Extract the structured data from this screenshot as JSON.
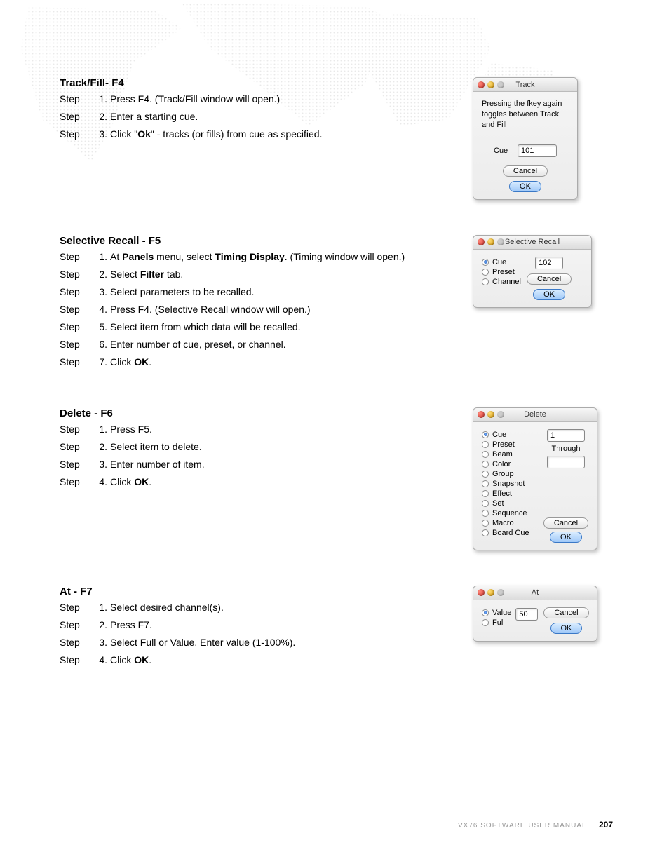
{
  "footer": {
    "text": "VX76 SOFTWARE USER MANUAL",
    "page": "207"
  },
  "sections": {
    "track": {
      "heading": "Track/Fill- F4",
      "steps": [
        "Press F4. (Track/Fill window will open.)",
        "Enter a starting cue.",
        "Click \"<b>Ok</b>\" - tracks (or fills) from cue as specified."
      ],
      "dialog": {
        "title": "Track",
        "message": "Pressing the fkey again toggles between Track and Fill",
        "cue_label": "Cue",
        "cue_value": "101",
        "cancel": "Cancel",
        "ok": "OK"
      }
    },
    "recall": {
      "heading": "Selective Recall - F5",
      "steps": [
        "At <b>Panels</b> menu, select <b>Timing Display</b>. (Timing window will open.)",
        "Select <b>Filter</b> tab.",
        "Select parameters to be recalled.",
        "Press F4. (Selective Recall window will open.)",
        "Select item from which data will be recalled.",
        "Enter number of cue, preset, or channel.",
        "Click <b>OK</b>."
      ],
      "dialog": {
        "title": "Selective Recall",
        "options": [
          "Cue",
          "Preset",
          "Channel"
        ],
        "value": "102",
        "cancel": "Cancel",
        "ok": "OK"
      }
    },
    "delete": {
      "heading": "Delete - F6",
      "steps": [
        "Press F5.",
        "Select item to delete.",
        "Enter number of item.",
        "Click <b>OK</b>."
      ],
      "dialog": {
        "title": "Delete",
        "options": [
          "Cue",
          "Preset",
          "Beam",
          "Color",
          "Group",
          "Snapshot",
          "Effect",
          "Set",
          "Sequence",
          "Macro",
          "Board Cue"
        ],
        "value1": "1",
        "through": "Through",
        "value2": "",
        "cancel": "Cancel",
        "ok": "OK"
      }
    },
    "at": {
      "heading": "At - F7",
      "steps": [
        "Select desired channel(s).",
        "Press F7.",
        "Select Full or Value. Enter value (1-100%).",
        "Click <b>OK</b>."
      ],
      "dialog": {
        "title": "At",
        "options": [
          "Value",
          "Full"
        ],
        "value": "50",
        "cancel": "Cancel",
        "ok": "OK"
      }
    }
  },
  "step_label": "Step"
}
